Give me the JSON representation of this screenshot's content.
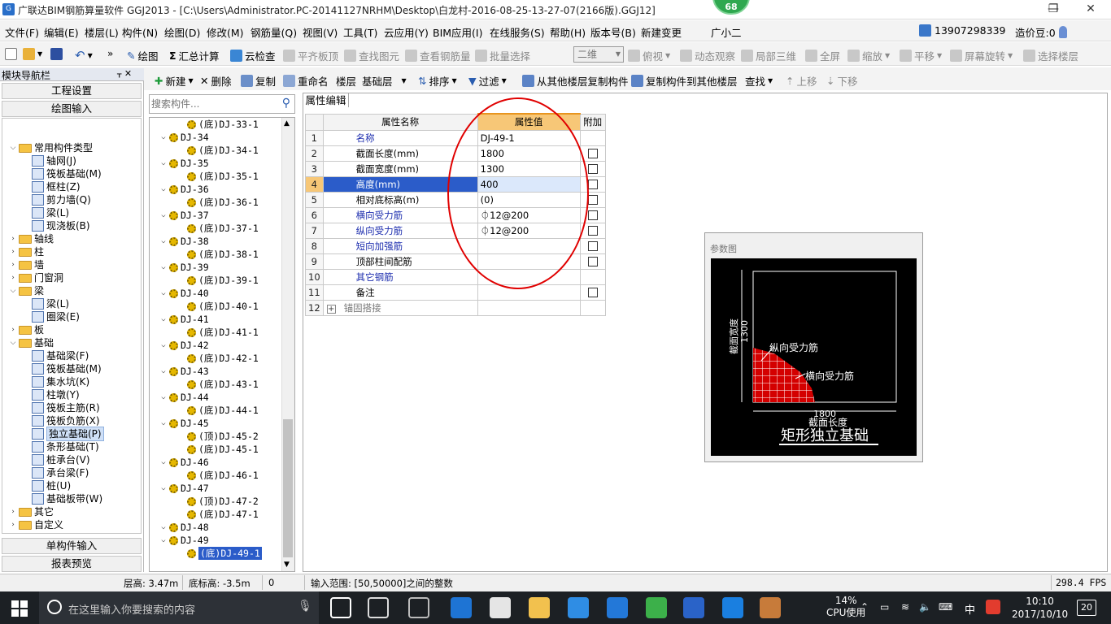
{
  "window": {
    "title": "广联达BIM钢筋算量软件 GGJ2013 - [C:\\Users\\Administrator.PC-20141127NRHM\\Desktop\\白龙村-2016-08-25-13-27-07(2166版).GGJ12]",
    "badge": "68",
    "minimize": "—",
    "restore": "❐",
    "close": "✕"
  },
  "menu": {
    "items": [
      "文件(F)",
      "编辑(E)",
      "楼层(L)",
      "构件(N)",
      "绘图(D)",
      "修改(M)",
      "钢筋量(Q)",
      "视图(V)",
      "工具(T)",
      "云应用(Y)",
      "BIM应用(I)",
      "在线服务(S)",
      "帮助(H)",
      "版本号(B)",
      "新建变更",
      "广小二"
    ],
    "phone": "13907298339",
    "coins": "造价豆:0"
  },
  "toolbar1": {
    "draw": "绘图",
    "summary": "汇总计算",
    "cloud_check": "云检查",
    "flat_slab": "平齐板顶",
    "find": "查找图元",
    "view_rebar": "查看钢筋量",
    "batch_select": "批量选择",
    "dim": "二维",
    "top_view": "俯视",
    "dynamic": "动态观察",
    "local3d": "局部三维",
    "full": "全屏",
    "zoom": "缩放",
    "pan": "平移",
    "rotate": "屏幕旋转",
    "select_floor": "选择楼层"
  },
  "toolbar2": {
    "new": "新建",
    "delete": "删除",
    "copy": "复制",
    "rename": "重命名",
    "floor": "楼层",
    "floor_value": "基础层",
    "sort": "排序",
    "filter": "过滤",
    "copy_from": "从其他楼层复制构件",
    "copy_to": "复制构件到其他楼层",
    "search": "查找",
    "up": "上移",
    "down": "下移"
  },
  "nav": {
    "title": "模块导航栏",
    "pin": "ᚁ ✕",
    "btn_project": "工程设置",
    "btn_draw": "绘图输入",
    "btn_single": "单构件输入",
    "btn_report": "报表预览",
    "tree": [
      {
        "label": "常用构件类型",
        "level": 0,
        "expanded": true,
        "folder": true
      },
      {
        "label": "轴网(J)",
        "level": 1
      },
      {
        "label": "筏板基础(M)",
        "level": 1
      },
      {
        "label": "框柱(Z)",
        "level": 1
      },
      {
        "label": "剪力墙(Q)",
        "level": 1
      },
      {
        "label": "梁(L)",
        "level": 1
      },
      {
        "label": "现浇板(B)",
        "level": 1
      },
      {
        "label": "轴线",
        "level": 0,
        "expanded": false,
        "folder": true
      },
      {
        "label": "柱",
        "level": 0,
        "expanded": false,
        "folder": true
      },
      {
        "label": "墙",
        "level": 0,
        "expanded": false,
        "folder": true
      },
      {
        "label": "门窗洞",
        "level": 0,
        "expanded": false,
        "folder": true
      },
      {
        "label": "梁",
        "level": 0,
        "expanded": true,
        "folder": true
      },
      {
        "label": "梁(L)",
        "level": 1
      },
      {
        "label": "圈梁(E)",
        "level": 1
      },
      {
        "label": "板",
        "level": 0,
        "expanded": false,
        "folder": true
      },
      {
        "label": "基础",
        "level": 0,
        "expanded": true,
        "folder": true
      },
      {
        "label": "基础梁(F)",
        "level": 1
      },
      {
        "label": "筏板基础(M)",
        "level": 1
      },
      {
        "label": "集水坑(K)",
        "level": 1
      },
      {
        "label": "柱墩(Y)",
        "level": 1
      },
      {
        "label": "筏板主筋(R)",
        "level": 1
      },
      {
        "label": "筏板负筋(X)",
        "level": 1
      },
      {
        "label": "独立基础(P)",
        "level": 1,
        "selected": true
      },
      {
        "label": "条形基础(T)",
        "level": 1
      },
      {
        "label": "桩承台(V)",
        "level": 1
      },
      {
        "label": "承台梁(F)",
        "level": 1
      },
      {
        "label": "桩(U)",
        "level": 1
      },
      {
        "label": "基础板带(W)",
        "level": 1
      },
      {
        "label": "其它",
        "level": 0,
        "expanded": false,
        "folder": true
      },
      {
        "label": "自定义",
        "level": 0,
        "expanded": false,
        "folder": true
      }
    ]
  },
  "components": {
    "search_placeholder": "搜索构件...",
    "tree": [
      {
        "label": "(底)DJ-33-1",
        "level": 1
      },
      {
        "label": "DJ-34",
        "level": 0
      },
      {
        "label": "(底)DJ-34-1",
        "level": 1
      },
      {
        "label": "DJ-35",
        "level": 0
      },
      {
        "label": "(底)DJ-35-1",
        "level": 1
      },
      {
        "label": "DJ-36",
        "level": 0
      },
      {
        "label": "(底)DJ-36-1",
        "level": 1
      },
      {
        "label": "DJ-37",
        "level": 0
      },
      {
        "label": "(底)DJ-37-1",
        "level": 1
      },
      {
        "label": "DJ-38",
        "level": 0
      },
      {
        "label": "(底)DJ-38-1",
        "level": 1
      },
      {
        "label": "DJ-39",
        "level": 0
      },
      {
        "label": "(底)DJ-39-1",
        "level": 1
      },
      {
        "label": "DJ-40",
        "level": 0
      },
      {
        "label": "(底)DJ-40-1",
        "level": 1
      },
      {
        "label": "DJ-41",
        "level": 0
      },
      {
        "label": "(底)DJ-41-1",
        "level": 1
      },
      {
        "label": "DJ-42",
        "level": 0
      },
      {
        "label": "(底)DJ-42-1",
        "level": 1
      },
      {
        "label": "DJ-43",
        "level": 0
      },
      {
        "label": "(底)DJ-43-1",
        "level": 1
      },
      {
        "label": "DJ-44",
        "level": 0
      },
      {
        "label": "(底)DJ-44-1",
        "level": 1
      },
      {
        "label": "DJ-45",
        "level": 0
      },
      {
        "label": "(顶)DJ-45-2",
        "level": 1
      },
      {
        "label": "(底)DJ-45-1",
        "level": 1
      },
      {
        "label": "DJ-46",
        "level": 0
      },
      {
        "label": "(底)DJ-46-1",
        "level": 1
      },
      {
        "label": "DJ-47",
        "level": 0
      },
      {
        "label": "(顶)DJ-47-2",
        "level": 1
      },
      {
        "label": "(底)DJ-47-1",
        "level": 1
      },
      {
        "label": "DJ-48",
        "level": 0
      },
      {
        "label": "DJ-49",
        "level": 0
      },
      {
        "label": "(底)DJ-49-1",
        "level": 1,
        "selected": true
      }
    ]
  },
  "properties": {
    "tab": "属性编辑",
    "headers": {
      "name": "属性名称",
      "value": "属性值",
      "extra": "附加"
    },
    "rows": [
      {
        "no": "1",
        "name": "名称",
        "value": "DJ-49-1",
        "blue": true,
        "check": false
      },
      {
        "no": "2",
        "name": "截面长度(mm)",
        "value": "1800",
        "blue": false,
        "check": true
      },
      {
        "no": "3",
        "name": "截面宽度(mm)",
        "value": "1300",
        "blue": false,
        "check": true
      },
      {
        "no": "4",
        "name": "高度(mm)",
        "value": "400",
        "blue": true,
        "check": true,
        "active": true
      },
      {
        "no": "5",
        "name": "相对底标高(m)",
        "value": "(0)",
        "blue": false,
        "check": true
      },
      {
        "no": "6",
        "name": "横向受力筋",
        "value": "⏀12@200",
        "blue": true,
        "check": true
      },
      {
        "no": "7",
        "name": "纵向受力筋",
        "value": "⏀12@200",
        "blue": true,
        "check": true
      },
      {
        "no": "8",
        "name": "短向加强筋",
        "value": "",
        "blue": true,
        "check": true
      },
      {
        "no": "9",
        "name": "顶部柱间配筋",
        "value": "",
        "blue": false,
        "check": true
      },
      {
        "no": "10",
        "name": "其它钢筋",
        "value": "",
        "blue": true,
        "check": false
      },
      {
        "no": "11",
        "name": "备注",
        "value": "",
        "blue": false,
        "check": true
      },
      {
        "no": "12",
        "name": "锚固搭接",
        "value": "",
        "blue": false,
        "check": false,
        "expand": true
      }
    ]
  },
  "param_figure": {
    "title": "参数图",
    "width_label": "截面宽度",
    "width_value": "1300",
    "length_label": "截面长度",
    "length_value": "1800",
    "long_rebar": "纵向受力筋",
    "trans_rebar": "横向受力筋",
    "caption": "矩形独立基础"
  },
  "status": {
    "floor_height": "层高: 3.47m",
    "bottom_elev": "底标高: -3.5m",
    "zero": "0",
    "input_range": "输入范围: [50,50000]之间的整数",
    "fps": "298.4 FPS"
  },
  "taskbar": {
    "search_placeholder": "在这里输入你要搜索的内容",
    "cpu_pct": "14%",
    "cpu_label": "CPU使用",
    "ime": "中",
    "time": "10:10",
    "date": "2017/10/10",
    "notif": "20"
  }
}
